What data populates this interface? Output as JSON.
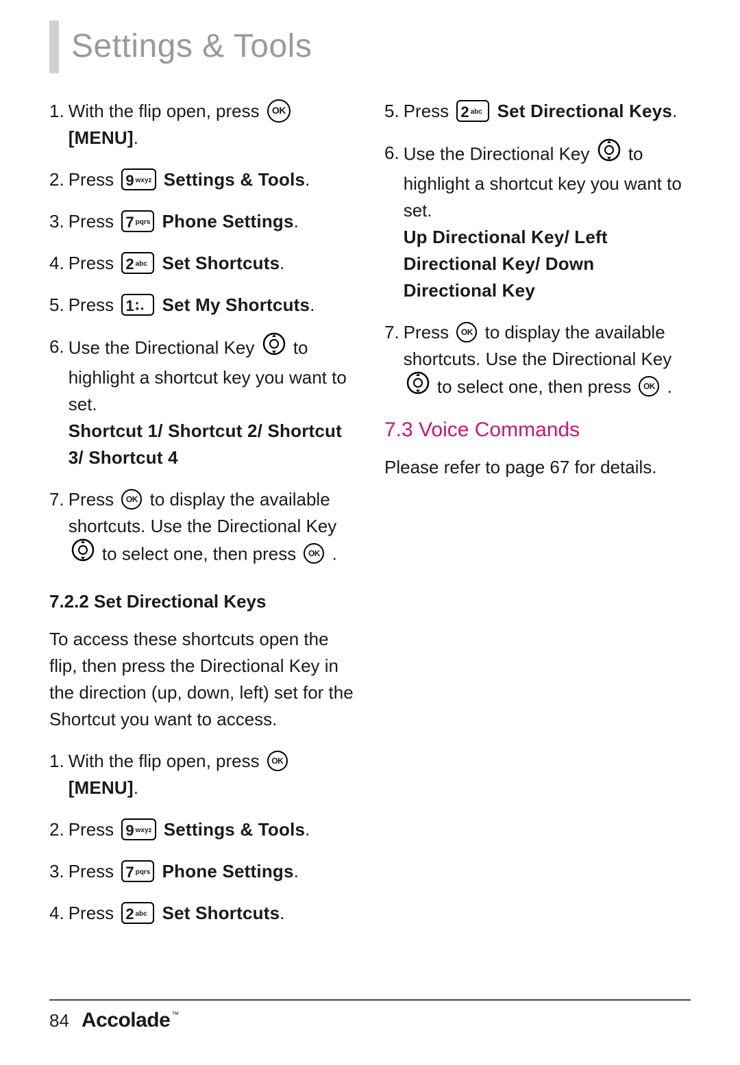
{
  "page": {
    "title": "Settings & Tools",
    "number": "84",
    "brand": "Accolade",
    "tm": "™"
  },
  "icons": {
    "ok": "OK",
    "key9_big": "9",
    "key9_small": "wxyz",
    "key7_big": "7",
    "key7_small": "pqrs",
    "key2_big": "2",
    "key2_small": "abc",
    "key1_big": "1"
  },
  "left": {
    "s1_num": "1.",
    "s1_a": "With the flip open, press ",
    "s1_b": "[MENU]",
    "s1_c": ".",
    "s2_num": "2.",
    "s2_a": "Press ",
    "s2_b": "Settings & Tools",
    "s2_c": ".",
    "s3_num": "3.",
    "s3_a": "Press ",
    "s3_b": "Phone Settings",
    "s3_c": ".",
    "s4_num": "4.",
    "s4_a": "Press ",
    "s4_b": "Set Shortcuts",
    "s4_c": ".",
    "s5_num": "5.",
    "s5_a": "Press ",
    "s5_b": "Set My Shortcuts",
    "s5_c": ".",
    "s6_num": "6.",
    "s6_a": "Use the Directional Key ",
    "s6_b": " to highlight a shortcut key you want to set.",
    "s6_c": "Shortcut 1/ Shortcut 2/ Shortcut 3/ Shortcut 4",
    "s7_num": "7.",
    "s7_a": "Press ",
    "s7_b": " to display the available shortcuts. Use the Directional Key ",
    "s7_c": " to select one, then press ",
    "s7_d": ".",
    "sub_title": "7.2.2 Set Directional Keys",
    "sub_para": "To access these shortcuts open the flip, then press the Directional Key in the direction (up, down, left) set for the Shortcut you want to access.",
    "d1_num": "1.",
    "d1_a": "With the flip open, press ",
    "d1_b": "[MENU]",
    "d1_c": ".",
    "d2_num": "2.",
    "d2_a": "Press ",
    "d2_b": "Settings & Tools",
    "d2_c": ".",
    "d3_num": "3.",
    "d3_a": "Press ",
    "d3_b": "Phone Settings",
    "d3_c": ".",
    "d4_num": "4.",
    "d4_a": "Press ",
    "d4_b": "Set Shortcuts",
    "d4_c": "."
  },
  "right": {
    "r5_num": "5.",
    "r5_a": "Press ",
    "r5_b": "Set Directional Keys",
    "r5_c": ".",
    "r6_num": "6.",
    "r6_a": "Use the Directional Key ",
    "r6_b": " to highlight a shortcut key you want to set.",
    "r6_c": "Up Directional Key/ Left Directional Key/ Down Directional Key",
    "r7_num": "7.",
    "r7_a": "Press ",
    "r7_b": " to display the available shortcuts. Use the Directional Key ",
    "r7_c": " to select one, then press ",
    "r7_d": ".",
    "section_heading": "7.3 Voice Commands",
    "section_para": "Please refer to page 67 for details."
  }
}
